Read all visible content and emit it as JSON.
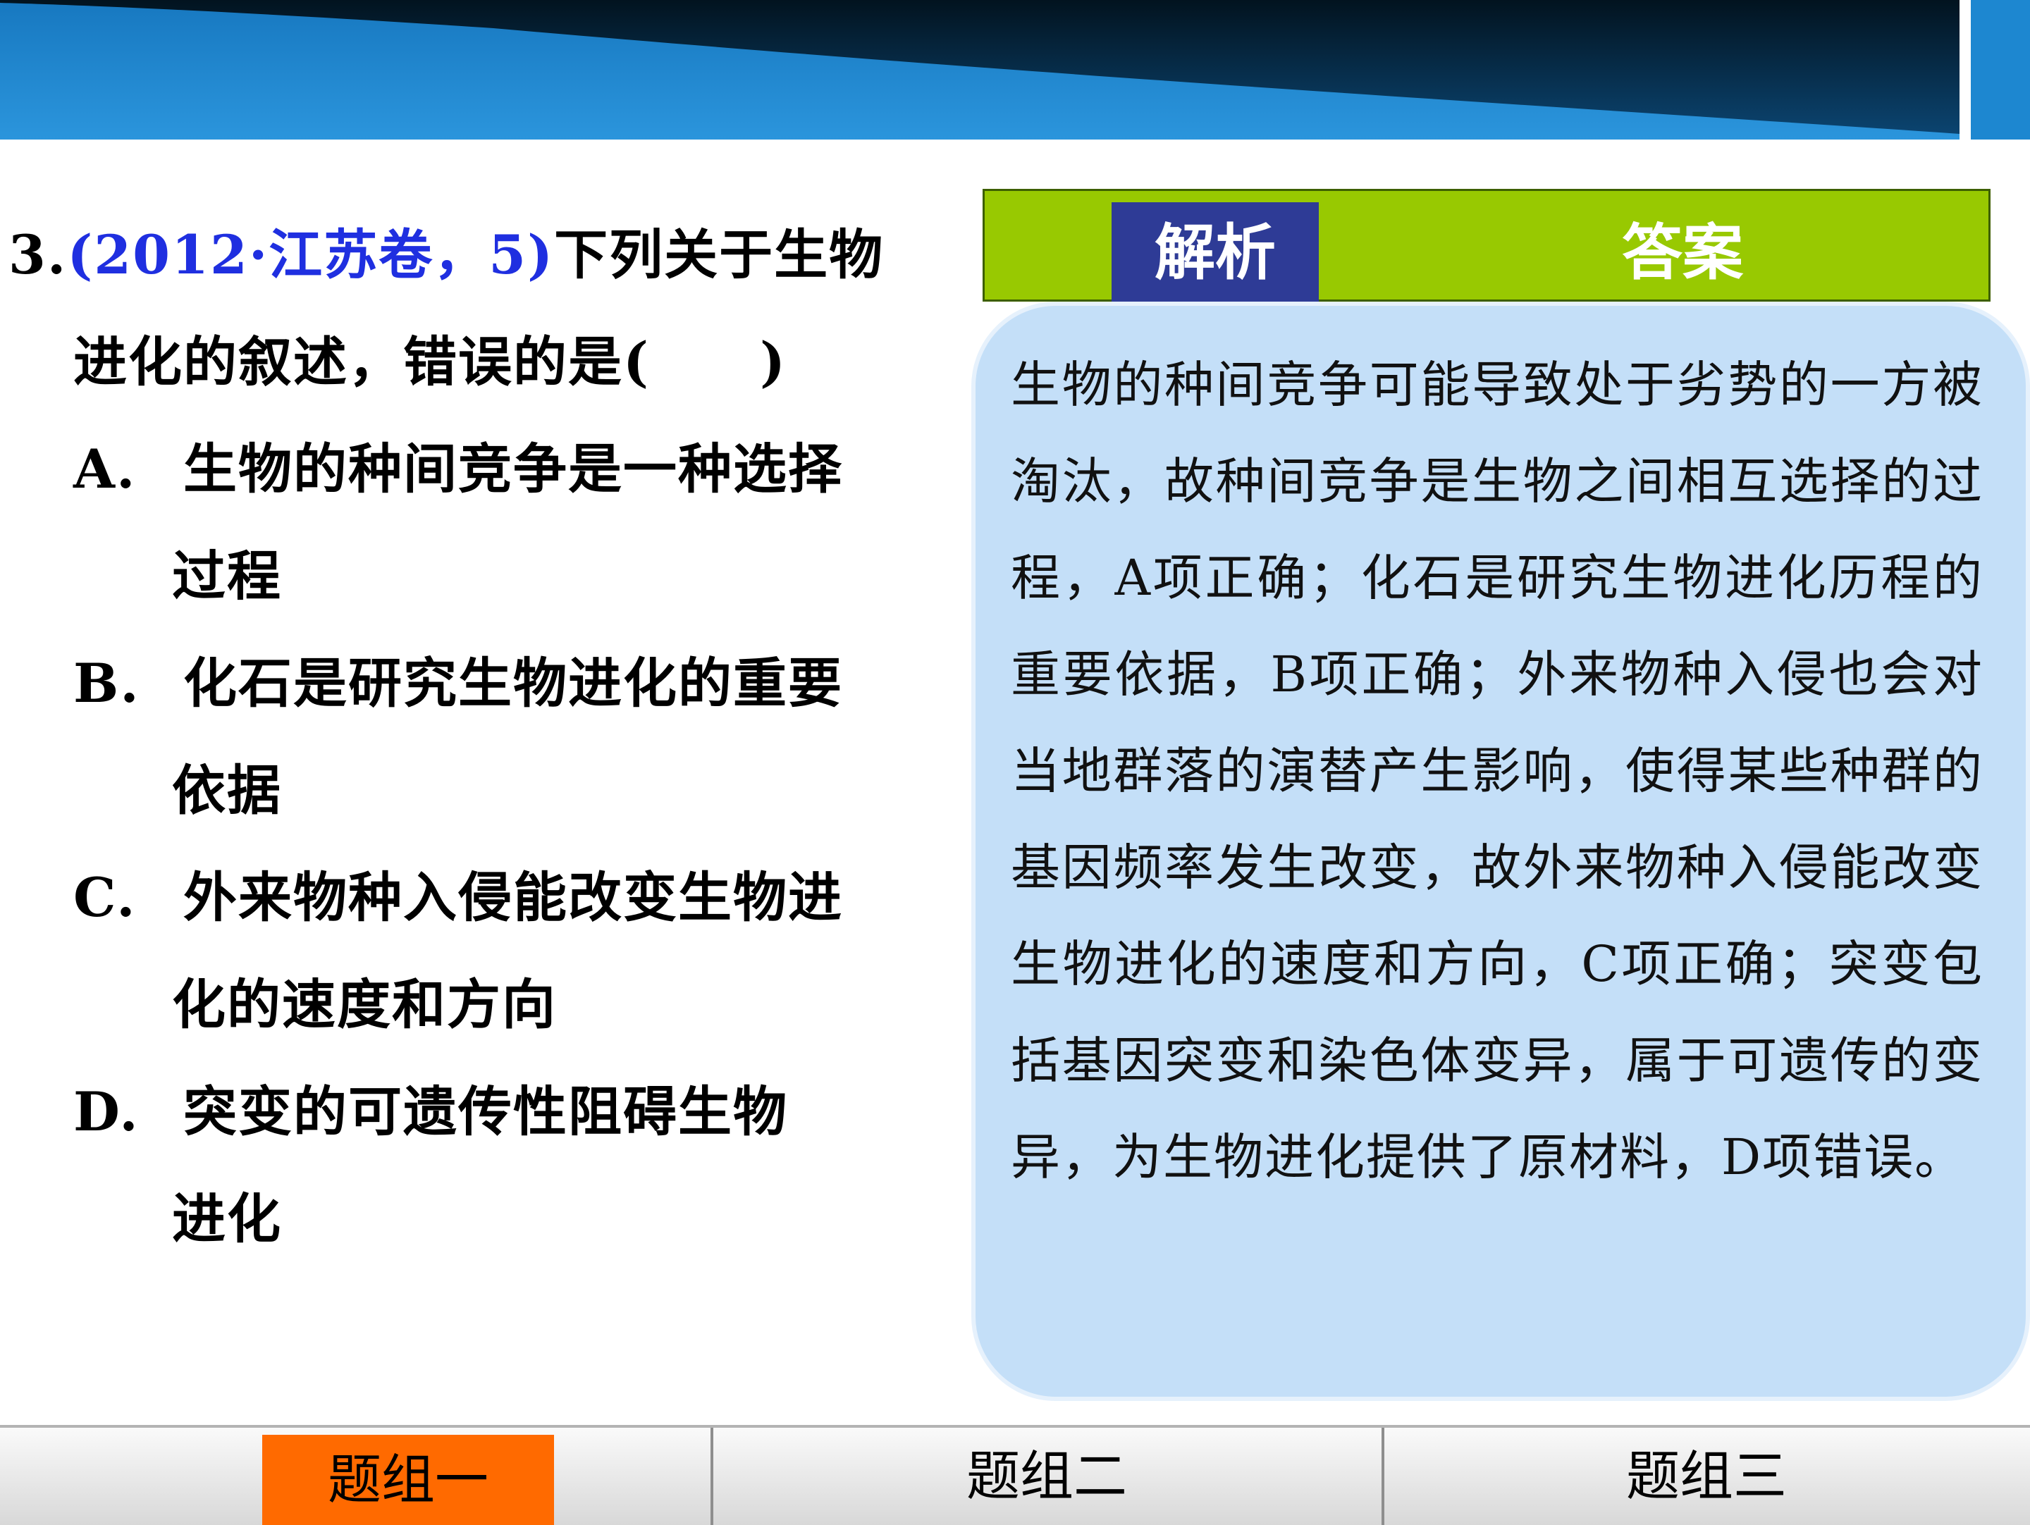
{
  "question": {
    "number": "3.",
    "source": "(2012·江苏卷，5)",
    "stem_line1": "下列关于生物",
    "stem_line2": "进化的叙述，错误的是(　　)",
    "options": [
      {
        "letter": "A.",
        "line1": "生物的种间竞争是一种选择",
        "line2": "过程"
      },
      {
        "letter": "B.",
        "line1": "化石是研究生物进化的重要",
        "line2": "依据"
      },
      {
        "letter": "C.",
        "line1": "外来物种入侵能改变生物进",
        "line2": "化的速度和方向"
      },
      {
        "letter": "D.",
        "line1": "突变的可遗传性阻碍生物",
        "line2": "进化"
      }
    ]
  },
  "tabs": {
    "analysis_label": "解析",
    "answer_label": "答案"
  },
  "analysis": {
    "text": "生物的种间竞争可能导致处于劣势的一方被淘汰，故种间竞争是生物之间相互选择的过程，A项正确；化石是研究生物进化历程的重要依据，B项正确；外来物种入侵也会对当地群落的演替产生影响，使得某些种群的基因频率发生改变，故外来物种入侵能改变生物进化的速度和方向，C项正确；突变包括基因突变和染色体变异，属于可遗传的变异，为生物进化提供了原材料，D项错误。"
  },
  "nav": {
    "tab1": "题组一",
    "tab2": "题组二",
    "tab3": "题组三"
  },
  "colors": {
    "banner": "#1d87d0",
    "tab_strip": "#98c901",
    "tab_active": "#2e3b96",
    "analysis_bg": "#c4dff8",
    "nav_active": "#ff6a00",
    "source_text": "#1f2fe0"
  }
}
